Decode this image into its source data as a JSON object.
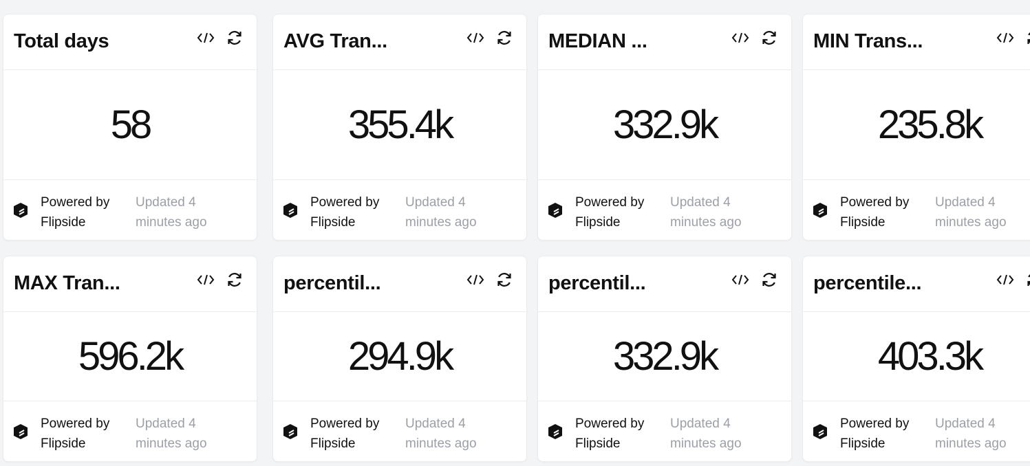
{
  "tiles": [
    {
      "title": "Total days",
      "value": "58"
    },
    {
      "title": "AVG Tran...",
      "value": "355.4k"
    },
    {
      "title": "MEDIAN ...",
      "value": "332.9k"
    },
    {
      "title": "MIN Trans...",
      "value": "235.8k"
    },
    {
      "title": "MAX Tran...",
      "value": "596.2k"
    },
    {
      "title": "percentil...",
      "value": "294.9k"
    },
    {
      "title": "percentil...",
      "value": "332.9k"
    },
    {
      "title": "percentile...",
      "value": "403.3k"
    }
  ],
  "footer": {
    "powered_line1": "Powered by",
    "powered_line2": "Flipside",
    "updated_line1": "Updated 4",
    "updated_line2": "minutes ago"
  },
  "icons": {
    "code": "code-icon",
    "refresh": "refresh-icon",
    "brand": "flipside-logo-icon"
  },
  "colors": {
    "background": "#f3f4f6",
    "card": "#ffffff",
    "text": "#111111",
    "muted": "#9ca0a6"
  }
}
